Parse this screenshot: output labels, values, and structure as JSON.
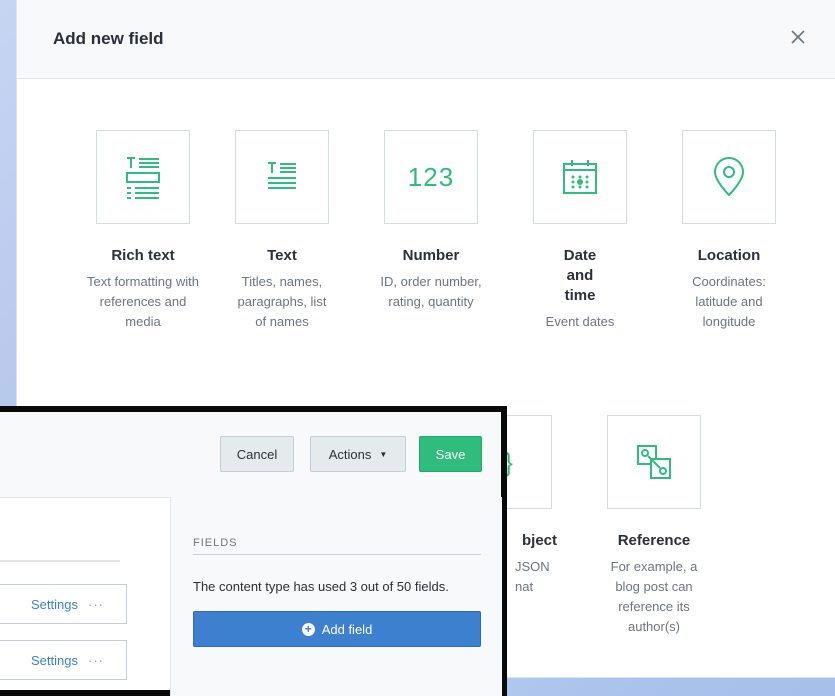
{
  "modal": {
    "title": "Add new field",
    "close_icon": "close-icon"
  },
  "field_types": [
    {
      "name": "Rich text",
      "desc": "Text formatting with references and media",
      "icon": "rich-text-icon"
    },
    {
      "name": "Text",
      "desc": "Titles, names, paragraphs, list of names",
      "icon": "text-icon"
    },
    {
      "name": "Number",
      "desc": "ID, order number, rating, quantity",
      "icon": "number-icon",
      "icon_text": "123"
    },
    {
      "name": "Date and time",
      "desc": "Event dates",
      "icon": "calendar-icon"
    },
    {
      "name": "Location",
      "desc": "Coordinates: latitude and longitude",
      "icon": "location-pin-icon"
    },
    {
      "name_partial": "bject",
      "desc_partial_1": "JSON",
      "desc_partial_2": "nat",
      "icon": "json-object-icon",
      "icon_text": ".}"
    },
    {
      "name": "Reference",
      "desc": "For example, a blog post can reference its author(s)",
      "icon": "reference-icon"
    }
  ],
  "editor": {
    "cancel_label": "Cancel",
    "actions_label": "Actions",
    "save_label": "Save",
    "fields_heading": "FIELDS",
    "fields_usage": "The content type has used 3 out of 50 fields.",
    "add_field_label": "Add field",
    "rows": [
      {
        "settings_label": "Settings",
        "more_label": "···"
      },
      {
        "settings_label": "Settings",
        "more_label": "···"
      }
    ]
  },
  "colors": {
    "accent_green": "#2ebd7d",
    "primary_blue": "#3c80cf"
  }
}
